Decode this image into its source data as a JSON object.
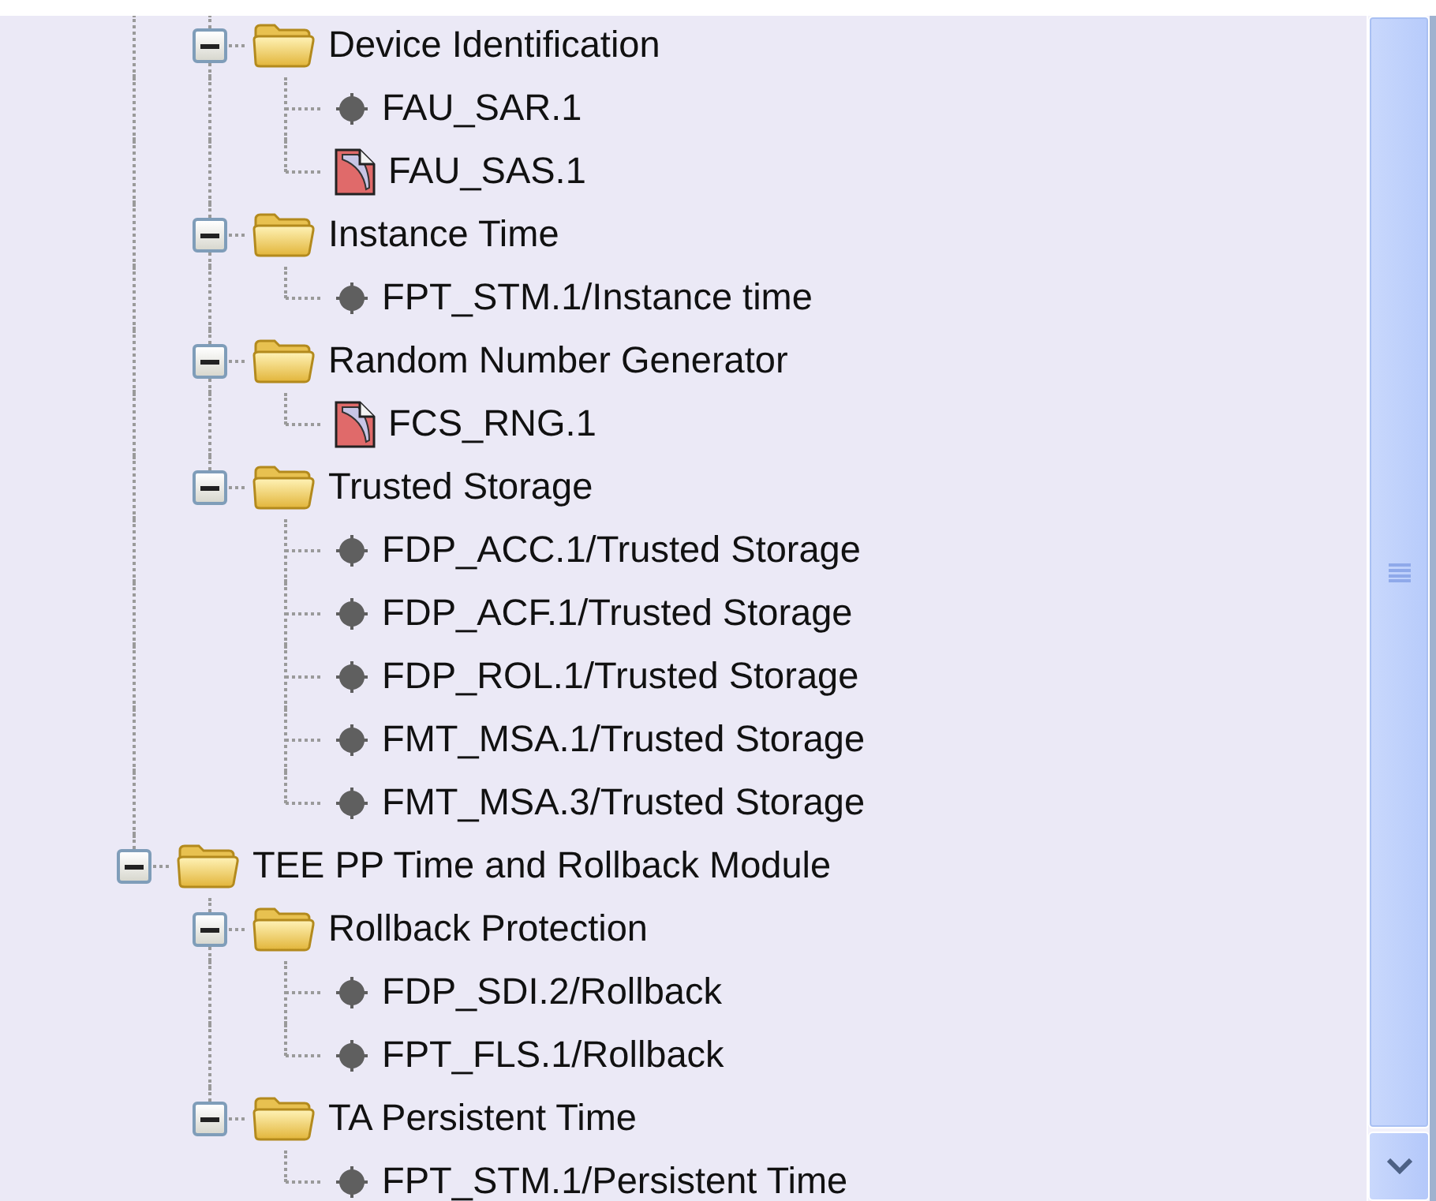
{
  "tree": {
    "items": [
      {
        "children": [
          {
            "label": "Device Identification",
            "expanded": true,
            "children": [
              {
                "kind": "requirement",
                "label": "FAU_SAR.1"
              },
              {
                "kind": "document",
                "label": "FAU_SAS.1"
              }
            ]
          },
          {
            "label": "Instance Time",
            "expanded": true,
            "children": [
              {
                "kind": "requirement",
                "label": "FPT_STM.1/Instance time"
              }
            ]
          },
          {
            "label": "Random Number Generator",
            "expanded": true,
            "children": [
              {
                "kind": "document",
                "label": "FCS_RNG.1"
              }
            ]
          },
          {
            "label": "Trusted Storage",
            "expanded": true,
            "children": [
              {
                "kind": "requirement",
                "label": "FDP_ACC.1/Trusted Storage"
              },
              {
                "kind": "requirement",
                "label": "FDP_ACF.1/Trusted Storage"
              },
              {
                "kind": "requirement",
                "label": "FDP_ROL.1/Trusted Storage"
              },
              {
                "kind": "requirement",
                "label": "FMT_MSA.1/Trusted Storage"
              },
              {
                "kind": "requirement",
                "label": "FMT_MSA.3/Trusted Storage"
              }
            ]
          }
        ]
      },
      {
        "label": "TEE PP Time and Rollback Module",
        "expanded": true,
        "children": [
          {
            "label": "Rollback Protection",
            "expanded": true,
            "children": [
              {
                "kind": "requirement",
                "label": "FDP_SDI.2/Rollback"
              },
              {
                "kind": "requirement",
                "label": "FPT_FLS.1/Rollback"
              }
            ]
          },
          {
            "label": "TA Persistent Time",
            "expanded": true,
            "children": [
              {
                "kind": "requirement",
                "label": "FPT_STM.1/Persistent Time"
              }
            ]
          }
        ]
      }
    ]
  }
}
